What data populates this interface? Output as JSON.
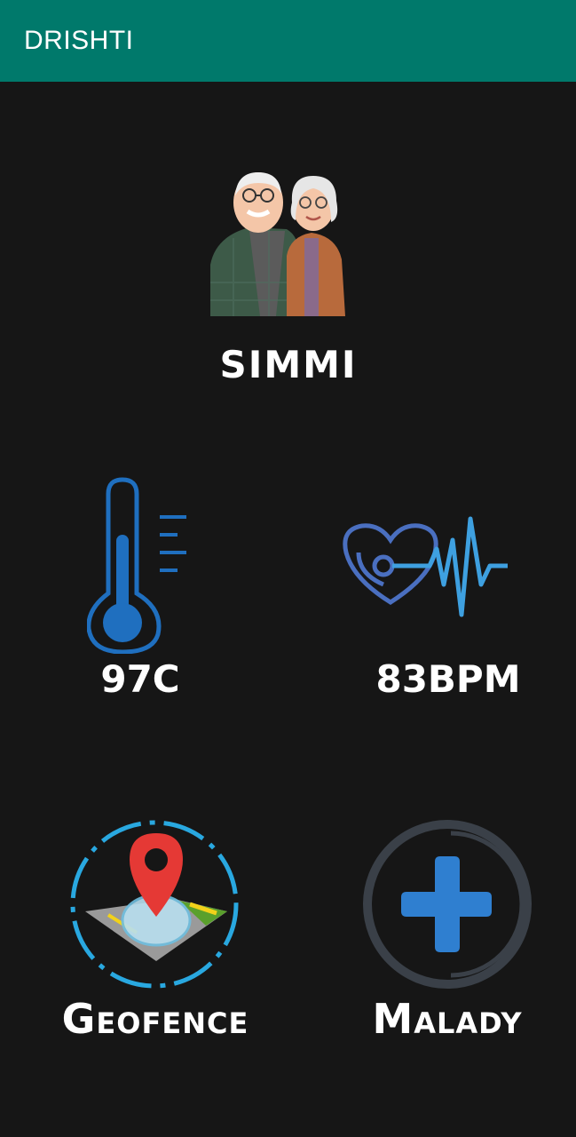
{
  "app_bar": {
    "title": "DRISHTI"
  },
  "profile": {
    "name": "SIMMI",
    "avatar_icon": "elderly-couple-avatar"
  },
  "vitals": {
    "temperature": {
      "value": "97C",
      "icon": "thermometer-icon",
      "color": "#1f6fbf"
    },
    "heart_rate": {
      "value": "83BPM",
      "icon": "heartbeat-icon",
      "color": "#3f8fd8"
    }
  },
  "features": {
    "geofence": {
      "label": "Geofence",
      "icon": "geofence-map-pin-icon",
      "pin_color": "#e53935",
      "ring_color": "#29a8e0"
    },
    "malady": {
      "label": "Malady",
      "icon": "medical-cross-icon",
      "cross_color": "#2f7fd0",
      "ring_color": "#3a4048"
    }
  },
  "colors": {
    "app_bar": "#00796b",
    "background": "#161616"
  }
}
